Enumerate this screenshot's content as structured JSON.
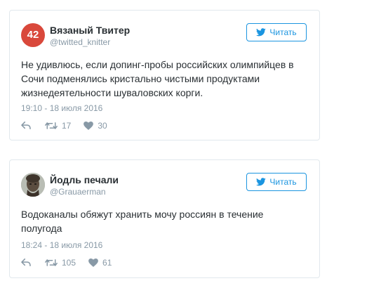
{
  "tweets": [
    {
      "avatar_text": "42",
      "name": "Вязаный Твитер",
      "handle": "@twitted_knitter",
      "follow_label": "Читать",
      "text": "Не удивлюсь, если допинг-пробы российских олимпийцев в Сочи подменялись кристально чистыми продуктами жизнедеятельности шуваловских корги.",
      "time": "19:10 - 18 июля 2016",
      "retweets": "17",
      "likes": "30"
    },
    {
      "name": "Йодль печали",
      "handle": "@Grauaerman",
      "follow_label": "Читать",
      "text": "Водоканалы обяжут хранить мочу россиян в течение полугода",
      "time": "18:24 - 18 июля 2016",
      "retweets": "105",
      "likes": "61"
    }
  ],
  "colors": {
    "accent": "#1b95e0",
    "muted": "#8899a6",
    "text": "#292f33",
    "border": "#e1e8ed",
    "avatar_42": "#d9483b"
  },
  "icons": {
    "follow": "twitter-bird-icon",
    "reply": "reply-icon",
    "retweet": "retweet-icon",
    "like": "heart-icon"
  }
}
